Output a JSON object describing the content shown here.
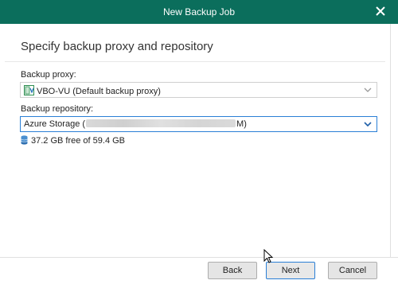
{
  "window": {
    "title": "New Backup Job",
    "close_icon": "close-icon",
    "accent_color": "#0b6e5c"
  },
  "page": {
    "heading": "Specify backup proxy and repository"
  },
  "proxy": {
    "label": "Backup proxy:",
    "value": "VBO-VU (Default backup proxy)",
    "icon": "proxy-server-icon"
  },
  "repository": {
    "label": "Backup repository:",
    "value_prefix": "Azure Storage (",
    "value_suffix": "M)",
    "capacity": "37.2 GB free of 59.4 GB",
    "capacity_icon": "storage-icon"
  },
  "buttons": {
    "back": "Back",
    "next": "Next",
    "cancel": "Cancel"
  }
}
